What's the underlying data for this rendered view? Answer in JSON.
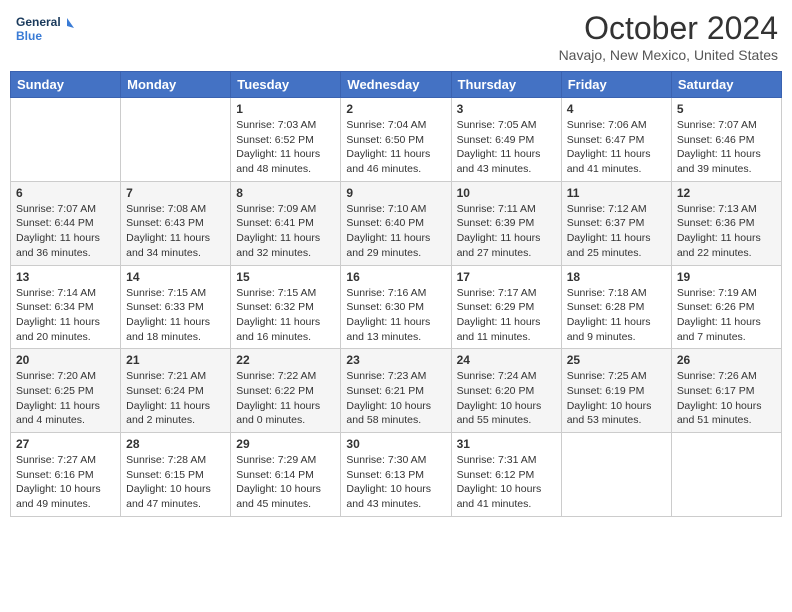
{
  "header": {
    "logo_general": "General",
    "logo_blue": "Blue",
    "month": "October 2024",
    "location": "Navajo, New Mexico, United States"
  },
  "weekdays": [
    "Sunday",
    "Monday",
    "Tuesday",
    "Wednesday",
    "Thursday",
    "Friday",
    "Saturday"
  ],
  "weeks": [
    [
      {
        "day": "",
        "sunrise": "",
        "sunset": "",
        "daylight": ""
      },
      {
        "day": "",
        "sunrise": "",
        "sunset": "",
        "daylight": ""
      },
      {
        "day": "1",
        "sunrise": "Sunrise: 7:03 AM",
        "sunset": "Sunset: 6:52 PM",
        "daylight": "Daylight: 11 hours and 48 minutes."
      },
      {
        "day": "2",
        "sunrise": "Sunrise: 7:04 AM",
        "sunset": "Sunset: 6:50 PM",
        "daylight": "Daylight: 11 hours and 46 minutes."
      },
      {
        "day": "3",
        "sunrise": "Sunrise: 7:05 AM",
        "sunset": "Sunset: 6:49 PM",
        "daylight": "Daylight: 11 hours and 43 minutes."
      },
      {
        "day": "4",
        "sunrise": "Sunrise: 7:06 AM",
        "sunset": "Sunset: 6:47 PM",
        "daylight": "Daylight: 11 hours and 41 minutes."
      },
      {
        "day": "5",
        "sunrise": "Sunrise: 7:07 AM",
        "sunset": "Sunset: 6:46 PM",
        "daylight": "Daylight: 11 hours and 39 minutes."
      }
    ],
    [
      {
        "day": "6",
        "sunrise": "Sunrise: 7:07 AM",
        "sunset": "Sunset: 6:44 PM",
        "daylight": "Daylight: 11 hours and 36 minutes."
      },
      {
        "day": "7",
        "sunrise": "Sunrise: 7:08 AM",
        "sunset": "Sunset: 6:43 PM",
        "daylight": "Daylight: 11 hours and 34 minutes."
      },
      {
        "day": "8",
        "sunrise": "Sunrise: 7:09 AM",
        "sunset": "Sunset: 6:41 PM",
        "daylight": "Daylight: 11 hours and 32 minutes."
      },
      {
        "day": "9",
        "sunrise": "Sunrise: 7:10 AM",
        "sunset": "Sunset: 6:40 PM",
        "daylight": "Daylight: 11 hours and 29 minutes."
      },
      {
        "day": "10",
        "sunrise": "Sunrise: 7:11 AM",
        "sunset": "Sunset: 6:39 PM",
        "daylight": "Daylight: 11 hours and 27 minutes."
      },
      {
        "day": "11",
        "sunrise": "Sunrise: 7:12 AM",
        "sunset": "Sunset: 6:37 PM",
        "daylight": "Daylight: 11 hours and 25 minutes."
      },
      {
        "day": "12",
        "sunrise": "Sunrise: 7:13 AM",
        "sunset": "Sunset: 6:36 PM",
        "daylight": "Daylight: 11 hours and 22 minutes."
      }
    ],
    [
      {
        "day": "13",
        "sunrise": "Sunrise: 7:14 AM",
        "sunset": "Sunset: 6:34 PM",
        "daylight": "Daylight: 11 hours and 20 minutes."
      },
      {
        "day": "14",
        "sunrise": "Sunrise: 7:15 AM",
        "sunset": "Sunset: 6:33 PM",
        "daylight": "Daylight: 11 hours and 18 minutes."
      },
      {
        "day": "15",
        "sunrise": "Sunrise: 7:15 AM",
        "sunset": "Sunset: 6:32 PM",
        "daylight": "Daylight: 11 hours and 16 minutes."
      },
      {
        "day": "16",
        "sunrise": "Sunrise: 7:16 AM",
        "sunset": "Sunset: 6:30 PM",
        "daylight": "Daylight: 11 hours and 13 minutes."
      },
      {
        "day": "17",
        "sunrise": "Sunrise: 7:17 AM",
        "sunset": "Sunset: 6:29 PM",
        "daylight": "Daylight: 11 hours and 11 minutes."
      },
      {
        "day": "18",
        "sunrise": "Sunrise: 7:18 AM",
        "sunset": "Sunset: 6:28 PM",
        "daylight": "Daylight: 11 hours and 9 minutes."
      },
      {
        "day": "19",
        "sunrise": "Sunrise: 7:19 AM",
        "sunset": "Sunset: 6:26 PM",
        "daylight": "Daylight: 11 hours and 7 minutes."
      }
    ],
    [
      {
        "day": "20",
        "sunrise": "Sunrise: 7:20 AM",
        "sunset": "Sunset: 6:25 PM",
        "daylight": "Daylight: 11 hours and 4 minutes."
      },
      {
        "day": "21",
        "sunrise": "Sunrise: 7:21 AM",
        "sunset": "Sunset: 6:24 PM",
        "daylight": "Daylight: 11 hours and 2 minutes."
      },
      {
        "day": "22",
        "sunrise": "Sunrise: 7:22 AM",
        "sunset": "Sunset: 6:22 PM",
        "daylight": "Daylight: 11 hours and 0 minutes."
      },
      {
        "day": "23",
        "sunrise": "Sunrise: 7:23 AM",
        "sunset": "Sunset: 6:21 PM",
        "daylight": "Daylight: 10 hours and 58 minutes."
      },
      {
        "day": "24",
        "sunrise": "Sunrise: 7:24 AM",
        "sunset": "Sunset: 6:20 PM",
        "daylight": "Daylight: 10 hours and 55 minutes."
      },
      {
        "day": "25",
        "sunrise": "Sunrise: 7:25 AM",
        "sunset": "Sunset: 6:19 PM",
        "daylight": "Daylight: 10 hours and 53 minutes."
      },
      {
        "day": "26",
        "sunrise": "Sunrise: 7:26 AM",
        "sunset": "Sunset: 6:17 PM",
        "daylight": "Daylight: 10 hours and 51 minutes."
      }
    ],
    [
      {
        "day": "27",
        "sunrise": "Sunrise: 7:27 AM",
        "sunset": "Sunset: 6:16 PM",
        "daylight": "Daylight: 10 hours and 49 minutes."
      },
      {
        "day": "28",
        "sunrise": "Sunrise: 7:28 AM",
        "sunset": "Sunset: 6:15 PM",
        "daylight": "Daylight: 10 hours and 47 minutes."
      },
      {
        "day": "29",
        "sunrise": "Sunrise: 7:29 AM",
        "sunset": "Sunset: 6:14 PM",
        "daylight": "Daylight: 10 hours and 45 minutes."
      },
      {
        "day": "30",
        "sunrise": "Sunrise: 7:30 AM",
        "sunset": "Sunset: 6:13 PM",
        "daylight": "Daylight: 10 hours and 43 minutes."
      },
      {
        "day": "31",
        "sunrise": "Sunrise: 7:31 AM",
        "sunset": "Sunset: 6:12 PM",
        "daylight": "Daylight: 10 hours and 41 minutes."
      },
      {
        "day": "",
        "sunrise": "",
        "sunset": "",
        "daylight": ""
      },
      {
        "day": "",
        "sunrise": "",
        "sunset": "",
        "daylight": ""
      }
    ]
  ]
}
